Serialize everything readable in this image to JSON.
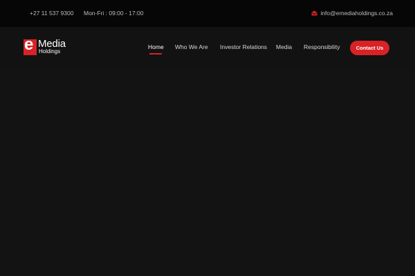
{
  "topbar": {
    "phone": "+27 11 537 9300",
    "hours": "Mon-Fri : 09:00 - 17:00",
    "email": "info@emediaholdings.co.za",
    "email_icon": "envelope-icon"
  },
  "logo": {
    "mark_letter": "e",
    "word_top": "Media",
    "word_bottom": "Holdings"
  },
  "nav": {
    "items": [
      {
        "label": "Home",
        "active": true
      },
      {
        "label": "Who We Are"
      },
      {
        "label": "Investor Relations"
      },
      {
        "label": "Media"
      },
      {
        "label": "Responsibility"
      }
    ],
    "contact_label": "Contact Us"
  },
  "colors": {
    "accent": "#d82226",
    "topbar_bg": "#060606",
    "page_bg": "#131313"
  }
}
